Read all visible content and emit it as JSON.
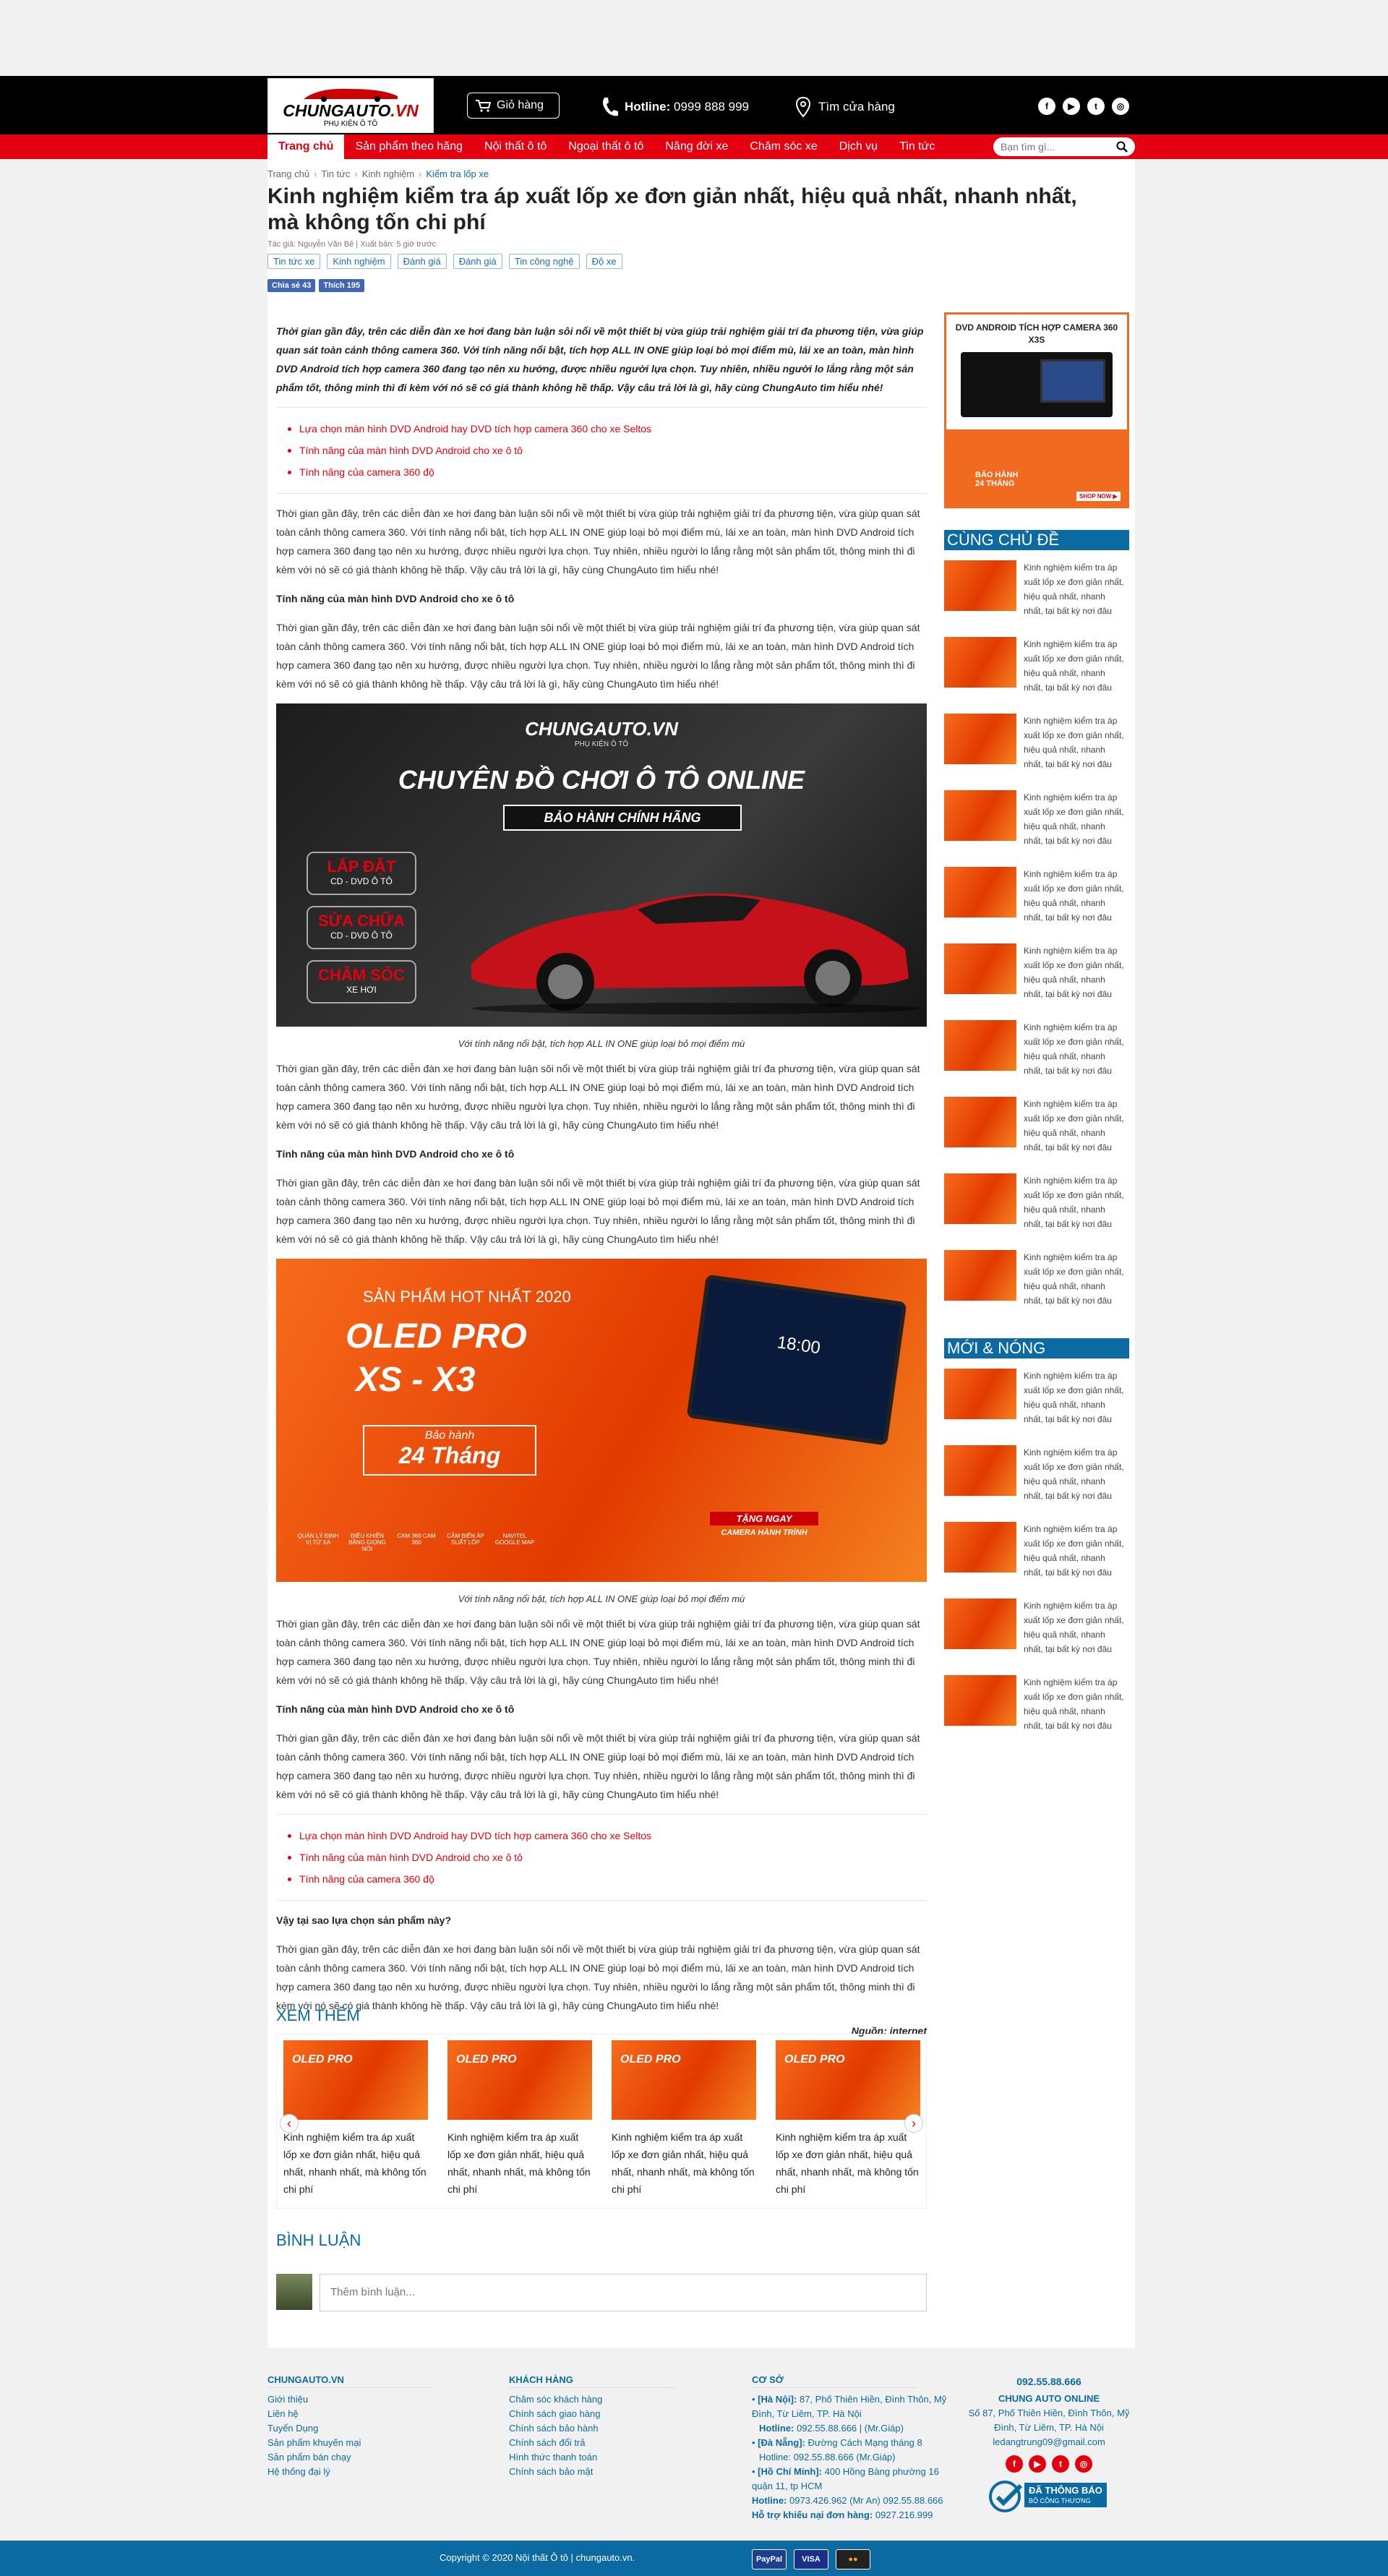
{
  "header": {
    "logo_text": "CHUNGAUTO",
    "logo_suffix": ".VN",
    "logo_sub": "PHỤ KIỆN Ô TÔ",
    "cart_label": "Giỏ hàng",
    "hotline_label": "Hotline:",
    "hotline_number": "0999 888 999",
    "store_label": "Tìm cửa hàng",
    "socials": [
      "f",
      "▶",
      "t",
      "◎"
    ]
  },
  "nav": {
    "items": [
      "Trang chủ",
      "Sản phẩm theo hãng",
      "Nội thất ô tô",
      "Ngoại thất ô tô",
      "Nâng đời xe",
      "Chăm sóc xe",
      "Dịch vụ",
      "Tin tức"
    ],
    "search_placeholder": "Bạn tìm gì..."
  },
  "breadcrumb": [
    "Trang chủ",
    "Tin tức",
    "Kinh nghiệm",
    "Kiểm tra lốp xe"
  ],
  "article": {
    "title": "Kinh nghiệm kiểm tra áp xuất lốp xe đơn giản nhất, hiệu quả nhất, nhanh nhất, mà không tốn chi phí",
    "meta": "Tác giả: Nguyễn Văn Bê  |  Xuất bản: 5 giờ trước",
    "tags": [
      "Tin tức xe",
      "Kinh nghiệm",
      "Đánh giá",
      "Đánh giá",
      "Tin công nghệ",
      "Độ xe"
    ],
    "share_label": "Chia sẻ 43",
    "like_label": "Thích 195",
    "lead": "Thời gian gần đây, trên các diễn đàn xe hơi đang bàn luận sôi nổi về một thiết bị vừa giúp trải nghiệm giải trí đa phương tiện, vừa giúp quan sát toàn cảnh thông camera 360. Với tính năng nổi bật, tích hợp ALL IN ONE giúp loại bỏ mọi điểm mù, lái xe an toàn, màn hình DVD Android tích hợp camera 360 đang tạo nên xu hướng, được nhiều người lựa chọn. Tuy nhiên, nhiều người lo lắng rằng một sản phẩm tốt, thông minh thì đi kèm với nó sẽ có giá thành không hề thấp. Vậy câu trả lời là gì, hãy cùng ChungAuto tìm hiểu nhé!",
    "toc": [
      "Lựa chọn màn hình DVD Android hay DVD tích hợp camera 360 cho xe Seltos",
      "Tính năng của màn hình DVD Android cho xe ô tô",
      "Tính năng của camera 360 độ"
    ],
    "paragraph": "Thời gian gần đây, trên các diễn đàn xe hơi đang bàn luận sôi nổi về một thiết bị vừa giúp trải nghiệm giải trí đa phương tiện, vừa giúp quan sát toàn cảnh thông camera 360. Với tính năng nổi bật, tích hợp ALL IN ONE giúp loại bỏ mọi điểm mù, lái xe an toàn, màn hình DVD Android tích hợp camera 360 đang tạo nên xu hướng, được nhiều người lựa chọn. Tuy nhiên, nhiều người lo lắng rằng một sản phẩm tốt, thông minh thì đi kèm với nó sẽ có giá thành không hề thấp. Vậy câu trả lời là gì, hãy cùng ChungAuto tìm hiểu nhé!",
    "subheading": "Tính năng của màn hình DVD Android cho xe ô tô",
    "caption": "Với tính năng nổi bật, tích hợp ALL IN ONE giúp loại bỏ mọi điểm mù",
    "why_heading": "Vậy tại sao lựa chọn sản phẩm này?",
    "source": "Nguồn: internet"
  },
  "banner1": {
    "brand": "CHUNGAUTO.VN",
    "brand_sub": "PHỤ KIỆN Ô TÔ",
    "headline": "CHUYÊN ĐỒ CHƠI Ô TÔ ONLINE",
    "badge": "BẢO HÀNH CHÍNH HÃNG",
    "services": [
      {
        "title": "LẮP ĐẶT",
        "sub": "CD - DVD Ô TÔ"
      },
      {
        "title": "SỬA CHỮA",
        "sub": "CD - DVD Ô TÔ"
      },
      {
        "title": "CHĂM SÓC",
        "sub": "XE HƠI"
      }
    ]
  },
  "banner2": {
    "top": "SẢN PHẨM HOT NHẤT 2020",
    "product": "OLED PRO",
    "model": "XS - X3",
    "warranty_top": "Bảo hành",
    "warranty": "24 Tháng",
    "screen_time": "18:00",
    "features": [
      "QUẢN LÝ ĐỊNH VỊ TỪ XA",
      "ĐIỀU KHIỂN BẰNG GIỌNG NÓI",
      "CAM 360 CAM 360",
      "CẢM BIẾN ÁP SUẤT LỐP",
      "NAVITEL GOOGLE MAP"
    ],
    "gift": "TẶNG NGAY",
    "gift_item": "CAMERA HÀNH TRÌNH"
  },
  "related": {
    "title": "XEM THÊM",
    "item_text": "Kinh nghiệm kiểm tra áp xuất lốp xe đơn giản nhất, hiệu quả nhất, nhanh nhất, mà không tốn chi phí"
  },
  "comments": {
    "title": "BÌNH LUẬN",
    "placeholder": "Thêm bình luận..."
  },
  "sidebar": {
    "ad_title": "DVD ANDROID TÍCH HỢP CAMERA 360 X3S",
    "ad_warranty": "BẢO HÀNH 24 THÁNG",
    "ad_cta": "SHOP NOW ▶",
    "same_topic": "CÙNG CHỦ ĐỀ",
    "new_hot": "MỚI & NÓNG",
    "item_text": "Kinh nghiệm kiểm tra áp xuất lốp xe đơn giản nhất, hiệu quả nhất, nhanh nhất, tại bất kỳ nơi đâu"
  },
  "footer": {
    "col1_title": "CHUNGAUTO.VN",
    "col1_links": [
      "Giới thiệu",
      "Liên hệ",
      "Tuyển Dụng",
      "Sản phẩm khuyến mại",
      "Sản phẩm bán chạy",
      "Hệ thống đại lý"
    ],
    "col2_title": "KHÁCH HÀNG",
    "col2_links": [
      "Chăm sóc khách hàng",
      "Chính sách giao hàng",
      "Chính sách bảo hành",
      "Chính sách đổi trả",
      "Hình thức thanh toán",
      "Chính sách bảo mật"
    ],
    "col3_title": "CƠ SỞ",
    "hn_label": "[Hà Nội]:",
    "hn_addr": "87, Phố Thiên Hiền, Đình Thôn, Mỹ Đình, Từ Liêm, TP. Hà Nội",
    "hn_hot_label": "Hotline:",
    "hn_hot": "092.55.88.666 | (Mr.Giáp)",
    "dn_label": "[Đà Nẵng]:",
    "dn_addr": "Đường Cách Mạng tháng 8",
    "dn_hot": "Hotline: 092.55.88.666 (Mr.Giáp)",
    "hcm_label": "[Hồ Chí Minh]:",
    "hcm_addr": "400 Hồng Bàng phường 16 quận 11, tp HCM",
    "hcm_hot_label": "Hotline:",
    "hcm_hot": "0973.426.962 (Mr An) 092.55.88.666",
    "complaint_label": "Hỗ trợ khiếu nại đơn hàng:",
    "complaint": "0927.216.999",
    "phone": "092.55.88.666",
    "company": "CHUNG AUTO ONLINE",
    "company_addr": "Số 87, Phố Thiên Hiền, Đình Thôn, Mỹ Đình, Từ Liêm, TP. Hà Nội",
    "email": "ledangtrung09@gmail.com",
    "socials": [
      "f",
      "▶",
      "t",
      "◎"
    ],
    "badge_line1": "ĐÃ THÔNG BÁO",
    "badge_line2": "BỘ CÔNG THƯƠNG"
  },
  "bottom": {
    "copyright": "Copyright © 2020 Nội thất Ô tô | chungauto.vn.",
    "payments": [
      "PayPal",
      "VISA",
      "●●"
    ]
  }
}
